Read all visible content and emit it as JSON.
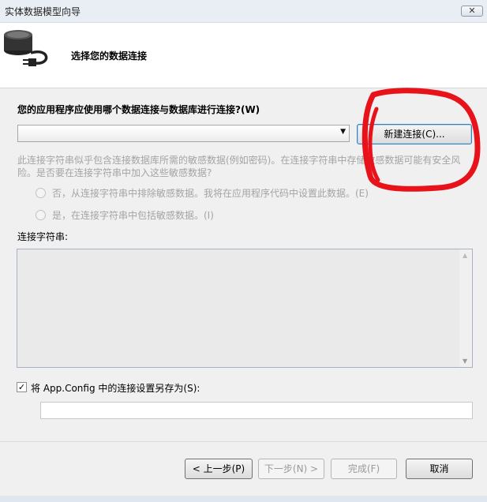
{
  "window": {
    "title": "实体数据模型向导",
    "close_label": "✕"
  },
  "header": {
    "title": "选择您的数据连接",
    "icon": "database-plug-icon"
  },
  "question": "您的应用程序应使用哪个数据连接与数据库进行连接?(W)",
  "connection_dropdown": {
    "value": ""
  },
  "new_connection_button": "新建连接(C)...",
  "sensitive_info": "此连接字符串似乎包含连接数据库所需的敏感数据(例如密码)。在连接字符串中存储敏感数据可能有安全风险。是否要在连接字符串中加入这些敏感数据?",
  "radio_options": [
    {
      "label": "否，从连接字符串中排除敏感数据。我将在应用程序代码中设置此数据。(E)",
      "enabled": false
    },
    {
      "label": "是，在连接字符串中包括敏感数据。(I)",
      "enabled": false
    }
  ],
  "connection_string": {
    "label": "连接字符串:",
    "value": ""
  },
  "save_config": {
    "checked": true,
    "check_mark": "✓",
    "label": "将 App.Config 中的连接设置另存为(S):",
    "value": ""
  },
  "buttons": {
    "back": "< 上一步(P)",
    "next": "下一步(N) >",
    "finish": "完成(F)",
    "cancel": "取消"
  },
  "colors": {
    "disabled_text": "#a4a4a4",
    "header_bg": "#ffffff",
    "body_bg": "#f0f0f0",
    "annotation": "#e8131a"
  }
}
